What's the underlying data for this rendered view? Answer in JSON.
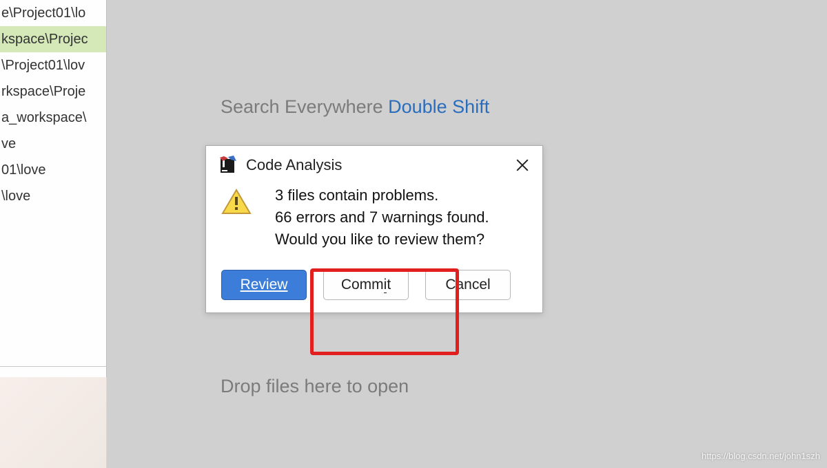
{
  "sidebar": {
    "items": [
      {
        "label": "e\\Project01\\lo",
        "highlighted": false
      },
      {
        "label": "kspace\\Projec",
        "highlighted": true
      },
      {
        "label": "\\Project01\\lov",
        "highlighted": false
      },
      {
        "label": "rkspace\\Proje",
        "highlighted": false
      },
      {
        "label": "a_workspace\\",
        "highlighted": false
      },
      {
        "label": "ve",
        "highlighted": false
      },
      {
        "label": "01\\love",
        "highlighted": false
      },
      {
        "label": "\\love",
        "highlighted": false
      }
    ]
  },
  "hints": {
    "search_label": "Search Everywhere ",
    "search_shortcut": "Double Shift",
    "drop_label": "Drop files here to open"
  },
  "dialog": {
    "title": "Code Analysis",
    "message_line1": "3 files contain problems.",
    "message_line2": "66 errors and 7 warnings found.",
    "message_line3": "Would you like to review them?",
    "review_label": "Review",
    "commit_label_pre": "Comm",
    "commit_label_mid": "i",
    "commit_label_post": "t",
    "cancel_label": "Cancel"
  },
  "watermark": "https://blog.csdn.net/john1szh"
}
